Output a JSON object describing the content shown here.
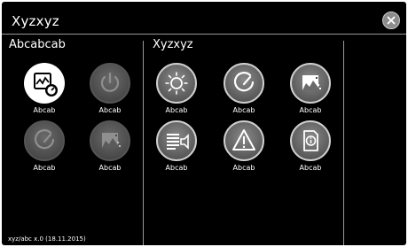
{
  "window": {
    "title": "Xyzxyz",
    "close_icon": "close-icon"
  },
  "left_panel": {
    "title": "Abcabcab",
    "tiles": [
      {
        "label": "Abcab",
        "icon": "chart-gauge-icon",
        "state": "active"
      },
      {
        "label": "Abcab",
        "icon": "power-icon",
        "state": "dim"
      },
      {
        "label": "Abcab",
        "icon": "gauge-icon",
        "state": "dim"
      },
      {
        "label": "Abcab",
        "icon": "image-dots-icon",
        "state": "dim"
      }
    ]
  },
  "right_panel": {
    "title": "Xyzxyz",
    "tiles": [
      {
        "label": "Abcab",
        "icon": "brightness-icon",
        "state": "dark"
      },
      {
        "label": "Abcab",
        "icon": "gauge-icon",
        "state": "dark"
      },
      {
        "label": "Abcab",
        "icon": "image-dots-icon",
        "state": "dark"
      },
      {
        "label": "Abcab",
        "icon": "list-speaker-icon",
        "state": "dark"
      },
      {
        "label": "Abcab",
        "icon": "warning-icon",
        "state": "dark"
      },
      {
        "label": "Abcab",
        "icon": "info-document-icon",
        "state": "dark"
      }
    ]
  },
  "footer": {
    "version": "xyz/abc x.0 (18.11.2015)"
  }
}
